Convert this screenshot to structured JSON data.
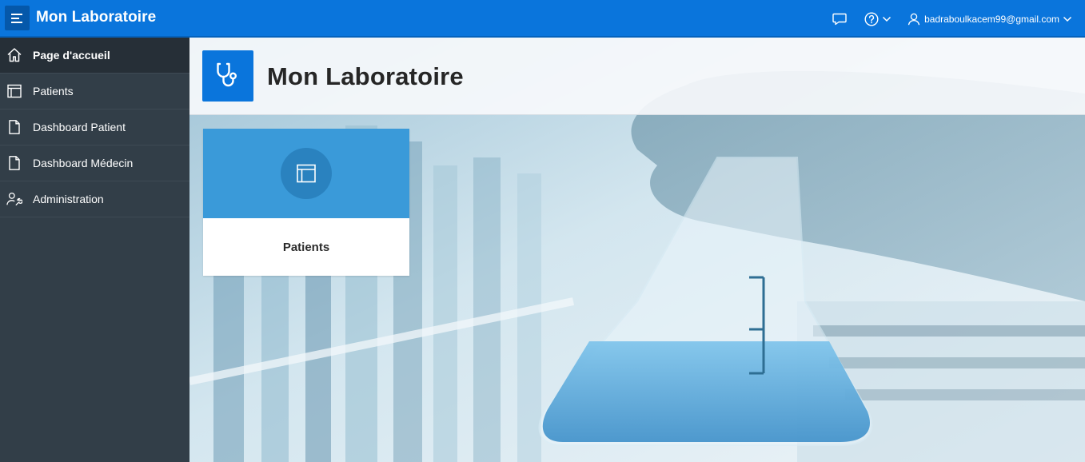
{
  "app": {
    "title": "Mon Laboratoire",
    "accent_color": "#0a75dc"
  },
  "topbar": {
    "menu_icon": "menu-icon",
    "feedback_icon": "chat-bubble-icon",
    "help_icon": "help-icon",
    "user": {
      "icon": "user-icon",
      "email": "badraboulkacem99@gmail.com"
    }
  },
  "sidebar": {
    "items": [
      {
        "label": "Page d'accueil",
        "icon": "home-icon",
        "active": true
      },
      {
        "label": "Patients",
        "icon": "table-layout-icon",
        "active": false
      },
      {
        "label": "Dashboard Patient",
        "icon": "file-icon",
        "active": false
      },
      {
        "label": "Dashboard Médecin",
        "icon": "file-icon",
        "active": false
      },
      {
        "label": "Administration",
        "icon": "user-wrench-icon",
        "active": false
      }
    ]
  },
  "header": {
    "title": "Mon Laboratoire",
    "icon": "stethoscope-icon"
  },
  "cards": [
    {
      "label": "Patients",
      "icon": "table-layout-icon",
      "color": "#3a9ad9"
    }
  ]
}
